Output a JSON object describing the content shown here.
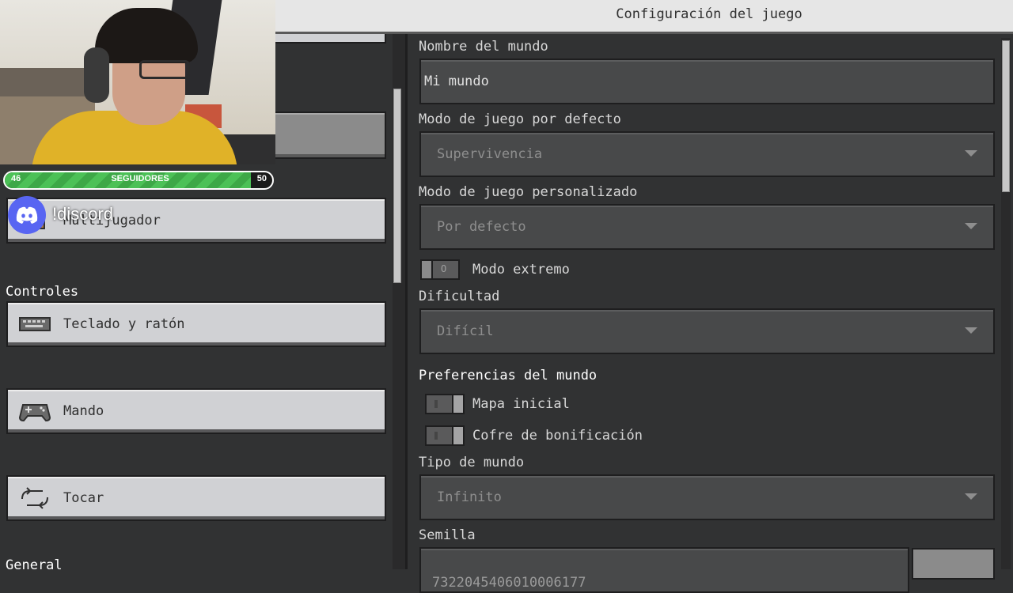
{
  "window": {
    "title": "Configuración del juego"
  },
  "left": {
    "buttons": [
      {
        "label": "Multijugador",
        "icon": "multiplayer-icon"
      },
      {
        "label": "Teclado y ratón",
        "icon": "keyboard-icon"
      },
      {
        "label": "Mando",
        "icon": "gamepad-icon"
      },
      {
        "label": "Tocar",
        "icon": "touch-icon"
      }
    ],
    "section_controls": "Controles",
    "section_general": "General"
  },
  "right": {
    "world_name_label": "Nombre del mundo",
    "world_name_value": "Mi mundo",
    "default_mode_label": "Modo de juego por defecto",
    "default_mode_value": "Supervivencia",
    "custom_mode_label": "Modo de juego personalizado",
    "custom_mode_value": "Por defecto",
    "hardcore_label": "Modo extremo",
    "hardcore_on": false,
    "difficulty_label": "Dificultad",
    "difficulty_value": "Difícil",
    "world_prefs_title": "Preferencias del mundo",
    "starter_map_label": "Mapa inicial",
    "starter_map_on": true,
    "bonus_chest_label": "Cofre de bonificación",
    "bonus_chest_on": true,
    "world_type_label": "Tipo de mundo",
    "world_type_value": "Infinito",
    "seed_label": "Semilla",
    "seed_value": "7322045406010006177"
  },
  "overlay": {
    "followers_current": "46",
    "followers_goal": "50",
    "followers_label": "SEGUIDORES",
    "followers_progress_fraction": 0.92,
    "discord_text": "!discord",
    "discord_color": "#5865f2"
  }
}
